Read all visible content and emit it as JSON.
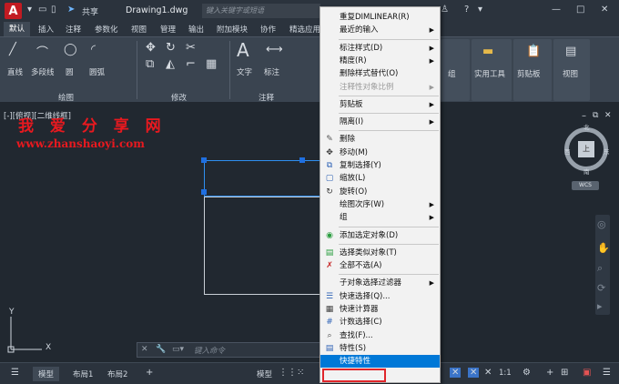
{
  "titlebar": {
    "logo": "A",
    "share": "共享",
    "doc_title": "Drawing1.dwg",
    "search_placeholder": "键入关键字或短语"
  },
  "tabs": [
    "默认",
    "插入",
    "注释",
    "参数化",
    "视图",
    "管理",
    "输出",
    "附加模块",
    "协作",
    "精选应用"
  ],
  "ribbon": {
    "draw_tools": [
      "直线",
      "多段线",
      "圆",
      "圆弧"
    ],
    "draw_panel": "绘图",
    "modify_panel": "修改",
    "annotate_tools": [
      "文字",
      "标注"
    ],
    "annotate_panel": "注释",
    "right_groups": [
      "组",
      "实用工具",
      "剪贴板",
      "视图"
    ]
  },
  "viewport_label": "[-][俯视][二维线框]",
  "watermark": {
    "line1": "我 爱 分 享 网",
    "line2": "www.zhanshaoyi.com"
  },
  "viewcube": {
    "top": "北",
    "center": "上",
    "west": "西",
    "east": "东",
    "south": "南",
    "wcs": "WCS"
  },
  "command": {
    "placeholder": "键入命令"
  },
  "statusbar": {
    "tabs": [
      "模型",
      "布局1",
      "布局2"
    ],
    "model_btn": "模型",
    "scale": "1:1"
  },
  "ucs": {
    "x": "X",
    "y": "Y"
  },
  "context_menu": [
    {
      "label": "重复DIMLINEAR(R)",
      "type": "item"
    },
    {
      "label": "最近的输入",
      "type": "sub"
    },
    {
      "type": "sep"
    },
    {
      "label": "标注样式(D)",
      "type": "sub"
    },
    {
      "label": "精度(R)",
      "type": "sub"
    },
    {
      "label": "删除样式替代(O)",
      "type": "item"
    },
    {
      "label": "注释性对象比例",
      "type": "disabled-sub"
    },
    {
      "type": "sep"
    },
    {
      "label": "剪贴板",
      "type": "sub"
    },
    {
      "type": "sep"
    },
    {
      "label": "隔离(I)",
      "type": "sub"
    },
    {
      "type": "sep"
    },
    {
      "label": "删除",
      "type": "item",
      "icon": "erase-icon"
    },
    {
      "label": "移动(M)",
      "type": "item",
      "icon": "move-icon"
    },
    {
      "label": "复制选择(Y)",
      "type": "item",
      "icon": "copy-icon"
    },
    {
      "label": "缩放(L)",
      "type": "item",
      "icon": "scale-icon"
    },
    {
      "label": "旋转(O)",
      "type": "item",
      "icon": "rotate-icon"
    },
    {
      "label": "绘图次序(W)",
      "type": "sub"
    },
    {
      "label": "组",
      "type": "sub"
    },
    {
      "type": "sep"
    },
    {
      "label": "添加选定对象(D)",
      "type": "item",
      "icon": "add-selected-icon"
    },
    {
      "type": "sep"
    },
    {
      "label": "选择类似对象(T)",
      "type": "item",
      "icon": "select-similar-icon"
    },
    {
      "label": "全部不选(A)",
      "type": "item",
      "icon": "deselect-all-icon"
    },
    {
      "type": "sep"
    },
    {
      "label": "子对象选择过滤器",
      "type": "sub"
    },
    {
      "label": "快速选择(Q)...",
      "type": "item",
      "icon": "quick-select-icon"
    },
    {
      "label": "快速计算器",
      "type": "item",
      "icon": "calculator-icon"
    },
    {
      "label": "计数选择(C)",
      "type": "item",
      "icon": "count-icon"
    },
    {
      "label": "查找(F)...",
      "type": "item",
      "icon": "find-icon"
    },
    {
      "label": "特性(S)",
      "type": "item",
      "icon": "properties-icon"
    },
    {
      "label": "快捷特性",
      "type": "highlight"
    }
  ]
}
